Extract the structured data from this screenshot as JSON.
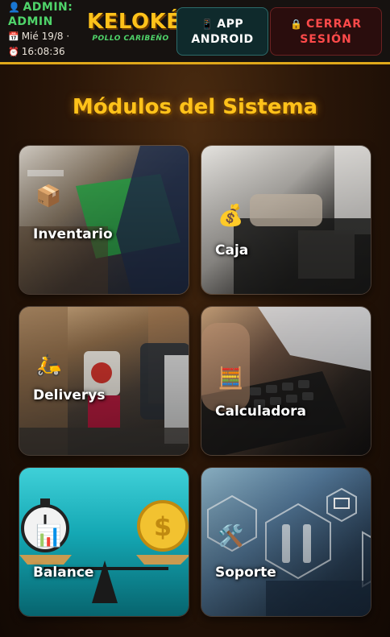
{
  "header": {
    "user_label": "ADMIN:",
    "user_name": "ADMIN",
    "date": "Mié 19/8 ·",
    "time": "16:08:36",
    "logo_main": "KELOKÉ",
    "logo_sub": "POLLO CARIBEÑO",
    "app_button_line1": "APP",
    "app_button_line2": "ANDROID",
    "logout_line1": "CERRAR",
    "logout_line2": "SESIÓN"
  },
  "title": "Módulos del Sistema",
  "modules": [
    {
      "label": "Inventario",
      "icon": "package-icon"
    },
    {
      "label": "Caja",
      "icon": "money-bag-icon"
    },
    {
      "label": "Deliverys",
      "icon": "scooter-icon"
    },
    {
      "label": "Calculadora",
      "icon": "abacus-icon"
    },
    {
      "label": "Balance",
      "icon": "chart-icon"
    },
    {
      "label": "Soporte",
      "icon": "tools-icon"
    }
  ],
  "colors": {
    "accent": "#ffc21a",
    "green": "#4fd46a",
    "danger": "#ff4a4a"
  }
}
